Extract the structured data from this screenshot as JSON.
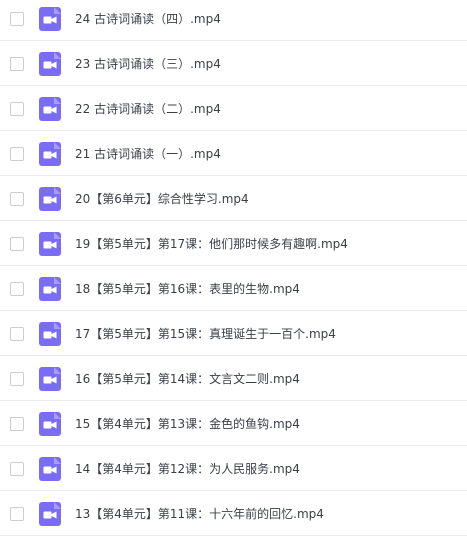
{
  "file_list": {
    "items": [
      {
        "name": "24 古诗词诵读（四）.mp4"
      },
      {
        "name": "23 古诗词诵读（三）.mp4"
      },
      {
        "name": "22 古诗词诵读（二）.mp4"
      },
      {
        "name": "21 古诗词诵读（一）.mp4"
      },
      {
        "name": "20【第6单元】综合性学习.mp4"
      },
      {
        "name": "19【第5单元】第17课：他们那时候多有趣啊.mp4"
      },
      {
        "name": "18【第5单元】第16课：表里的生物.mp4"
      },
      {
        "name": "17【第5单元】第15课：真理诞生于一百个.mp4"
      },
      {
        "name": "16【第5单元】第14课：文言文二则.mp4"
      },
      {
        "name": "15【第4单元】第13课：金色的鱼钩.mp4"
      },
      {
        "name": "14【第4单元】第12课：为人民服务.mp4"
      },
      {
        "name": "13【第4单元】第11课：十六年前的回忆.mp4"
      }
    ],
    "icon": "video-file-icon",
    "icon_color": "#7b6cf6"
  }
}
